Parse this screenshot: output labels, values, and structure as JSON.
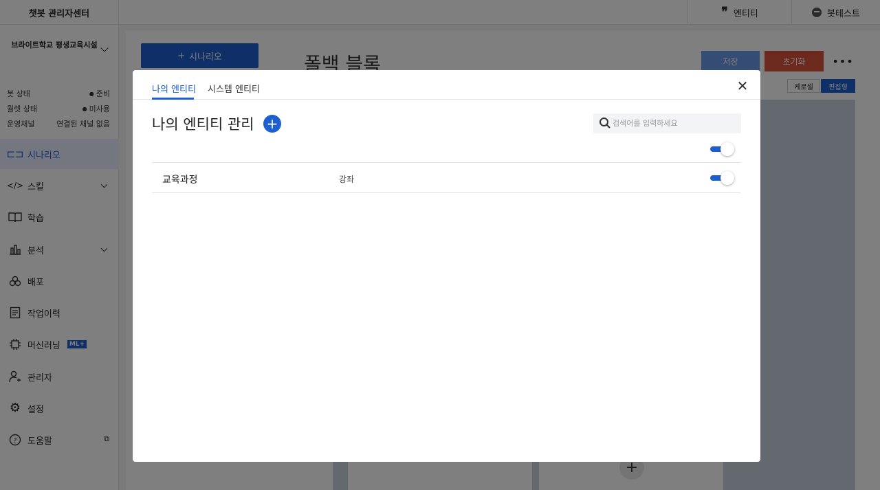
{
  "app": {
    "title": "챗봇 관리자센터"
  },
  "topbar": {
    "entity_label": "엔티티",
    "bot_test_label": "봇테스트"
  },
  "sidebar": {
    "org_name": "브라이트학교 평생교육시설",
    "status": [
      {
        "label": "봇 상태",
        "value": "준비"
      },
      {
        "label": "월렛 상태",
        "value": "미사용"
      },
      {
        "label": "운영채널",
        "value": "연결된 채널 없음"
      }
    ],
    "items": [
      {
        "label": "시나리오",
        "icon": "scenario-icon"
      },
      {
        "label": "스킬",
        "icon": "code-icon"
      },
      {
        "label": "학습",
        "icon": "book-icon"
      },
      {
        "label": "분석",
        "icon": "chart-icon"
      },
      {
        "label": "배포",
        "icon": "deploy-icon"
      },
      {
        "label": "작업이력",
        "icon": "history-icon"
      },
      {
        "label": "머신러닝",
        "icon": "chip-icon",
        "badge": "ML+"
      },
      {
        "label": "관리자",
        "icon": "user-icon"
      },
      {
        "label": "설정",
        "icon": "gear-icon"
      },
      {
        "label": "도움말",
        "icon": "help-icon"
      }
    ]
  },
  "main": {
    "add_scenario_label": "시나리오",
    "page_title": "폴백 블록",
    "save_label": "저장",
    "reset_label": "초기화",
    "seg_left": "케로셀",
    "seg_right": "편집형"
  },
  "modal": {
    "tabs": [
      {
        "label": "나의 엔티티"
      },
      {
        "label": "시스템 엔티티"
      }
    ],
    "title": "나의 엔티티 관리",
    "search_placeholder": "검색어를 입력하세요",
    "rows": [
      {
        "name": "교육과정",
        "value": "강좌"
      }
    ]
  },
  "colors": {
    "accent": "#1d5fd1",
    "danger": "#d9533b"
  }
}
